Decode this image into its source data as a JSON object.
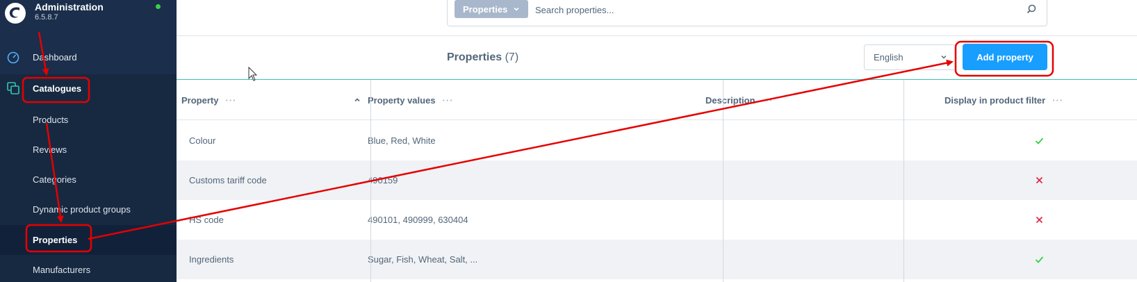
{
  "app": {
    "title": "Administration",
    "version": "6.5.8.7"
  },
  "sidebar": {
    "items": [
      {
        "label": "Dashboard"
      },
      {
        "label": "Catalogues"
      },
      {
        "label": "Products"
      },
      {
        "label": "Reviews"
      },
      {
        "label": "Categories"
      },
      {
        "label": "Dynamic product groups"
      },
      {
        "label": "Properties"
      },
      {
        "label": "Manufacturers"
      }
    ]
  },
  "search": {
    "type_label": "Properties",
    "placeholder": "Search properties..."
  },
  "page": {
    "title": "Properties",
    "count": "(7)"
  },
  "language": {
    "selected": "English"
  },
  "actions": {
    "add_label": "Add property"
  },
  "table": {
    "columns": [
      "Property",
      "Property values",
      "Description",
      "Display in product filter"
    ],
    "rows": [
      {
        "property": "Colour",
        "values": "Blue, Red, White",
        "description": "",
        "display_in_filter": true
      },
      {
        "property": "Customs tariff code",
        "values": "490159",
        "description": "",
        "display_in_filter": false
      },
      {
        "property": "HS code",
        "values": "490101, 490999, 630404",
        "description": "",
        "display_in_filter": false
      },
      {
        "property": "Ingredients",
        "values": "Sugar, Fish, Wheat, Salt, ...",
        "description": "",
        "display_in_filter": true
      }
    ]
  },
  "colors": {
    "sidebar": "#1b2e4b",
    "accent": "#189eff",
    "check": "#37d046",
    "cross": "#de294c",
    "annotation": "#e60000"
  }
}
